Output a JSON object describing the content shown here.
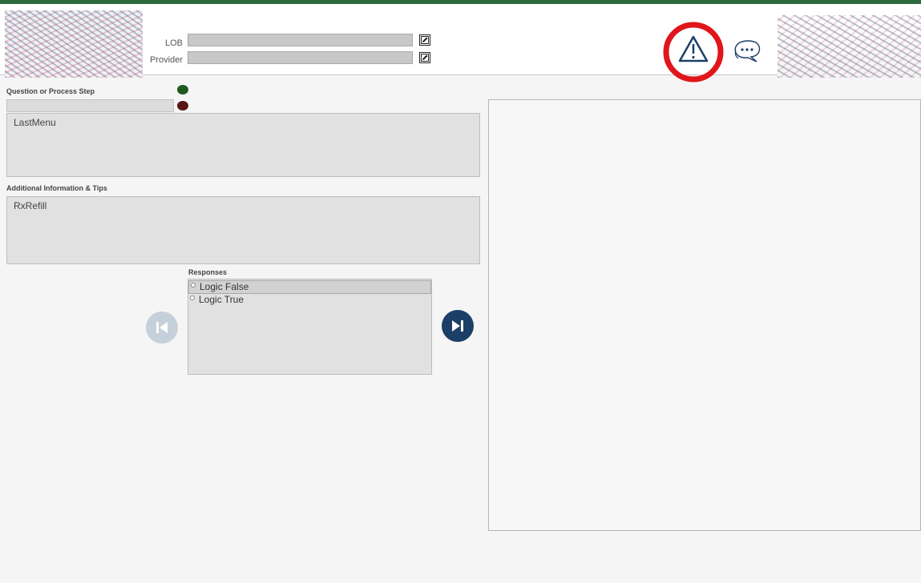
{
  "header": {
    "lob_label": "LOB",
    "lob_value": "",
    "provider_label": "Provider",
    "provider_value": ""
  },
  "icons": {
    "edit": "edit-icon",
    "alert": "warning-triangle-icon",
    "chat": "chat-bubble-icon",
    "first": "skip-first-icon",
    "next": "skip-next-icon"
  },
  "colors": {
    "brand_bar": "#2d6a3e",
    "status_green": "#1f5a1f",
    "status_red": "#5a1414",
    "highlight_circle": "#e0161b",
    "nav_active": "#1b3f66",
    "nav_disabled": "#c5d0db"
  },
  "question": {
    "section_label": "Question or Process Step",
    "text": "LastMenu"
  },
  "tips": {
    "section_label": "Additional Information & Tips",
    "text": "RxRefill"
  },
  "responses": {
    "section_label": "Responses",
    "items": [
      {
        "label": "Logic False",
        "selected": true
      },
      {
        "label": "Logic True",
        "selected": false
      }
    ]
  }
}
